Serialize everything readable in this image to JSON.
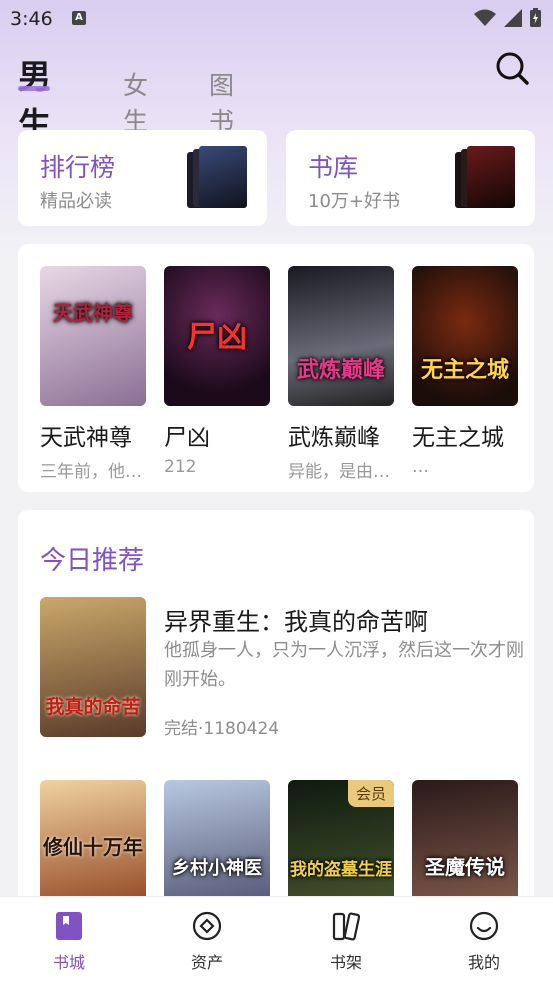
{
  "status_bar": {
    "time": "3:46",
    "notification_glyph": "A"
  },
  "tabs": [
    {
      "label": "男生",
      "active": true
    },
    {
      "label": "女生",
      "active": false
    },
    {
      "label": "图书",
      "active": false
    }
  ],
  "quick_cards": [
    {
      "title": "排行榜",
      "subtitle": "精品必读"
    },
    {
      "title": "书库",
      "subtitle": "10万+好书"
    }
  ],
  "book_row_1": [
    {
      "title": "天武神尊",
      "meta": "三年前，他…",
      "cover_text": "天武神尊",
      "colors": [
        "#e8d8e6",
        "#8a6f94"
      ],
      "text_color": "#b0213a"
    },
    {
      "title": "尸凶",
      "meta": "212",
      "cover_text": "尸凶",
      "colors": [
        "#3a1a3a",
        "#9a1a2a"
      ],
      "text_color": "#ff3030"
    },
    {
      "title": "武炼巅峰",
      "meta": "异能，是由…",
      "cover_text": "武炼巅峰",
      "colors": [
        "#1a1a22",
        "#6a6a78"
      ],
      "text_color": "#e8388a"
    },
    {
      "title": "无主之城",
      "meta": "…",
      "cover_text": "无主之城",
      "colors": [
        "#1a0d0a",
        "#7a2a10"
      ],
      "text_color": "#ffd34a"
    }
  ],
  "today": {
    "section_title": "今日推荐",
    "featured": {
      "title": "异界重生：我真的命苦啊",
      "description": "他孤身一人，只为一人沉浮，然后这一次才刚刚开始。",
      "status": "完结·1180424",
      "cover_text": "我真的命苦",
      "colors": [
        "#caa86a",
        "#5a3a2a"
      ],
      "text_color": "#c41a1a"
    },
    "books": [
      {
        "cover_text": "修仙十万年",
        "colors": [
          "#f0d2a0",
          "#8a3a18"
        ],
        "text_color": "#2a1408",
        "badge": ""
      },
      {
        "cover_text": "乡村小神医",
        "colors": [
          "#b8c8e0",
          "#4a4a6a"
        ],
        "text_color": "#ffffff",
        "badge": ""
      },
      {
        "cover_text": "我的盗墓生涯",
        "colors": [
          "#0f1a10",
          "#4a5a30"
        ],
        "text_color": "#f0d24a",
        "badge": "会员"
      },
      {
        "cover_text": "圣魔传说",
        "colors": [
          "#2a1a1a",
          "#8a6050"
        ],
        "text_color": "#ffffff",
        "badge": ""
      }
    ]
  },
  "bottom_nav": [
    {
      "label": "书城",
      "icon": "bookstore-icon",
      "active": true
    },
    {
      "label": "资产",
      "icon": "assets-icon",
      "active": false
    },
    {
      "label": "书架",
      "icon": "bookshelf-icon",
      "active": false
    },
    {
      "label": "我的",
      "icon": "profile-icon",
      "active": false
    }
  ],
  "colors": {
    "accent": "#8152c4",
    "vip_badge": "#e9c97a"
  }
}
